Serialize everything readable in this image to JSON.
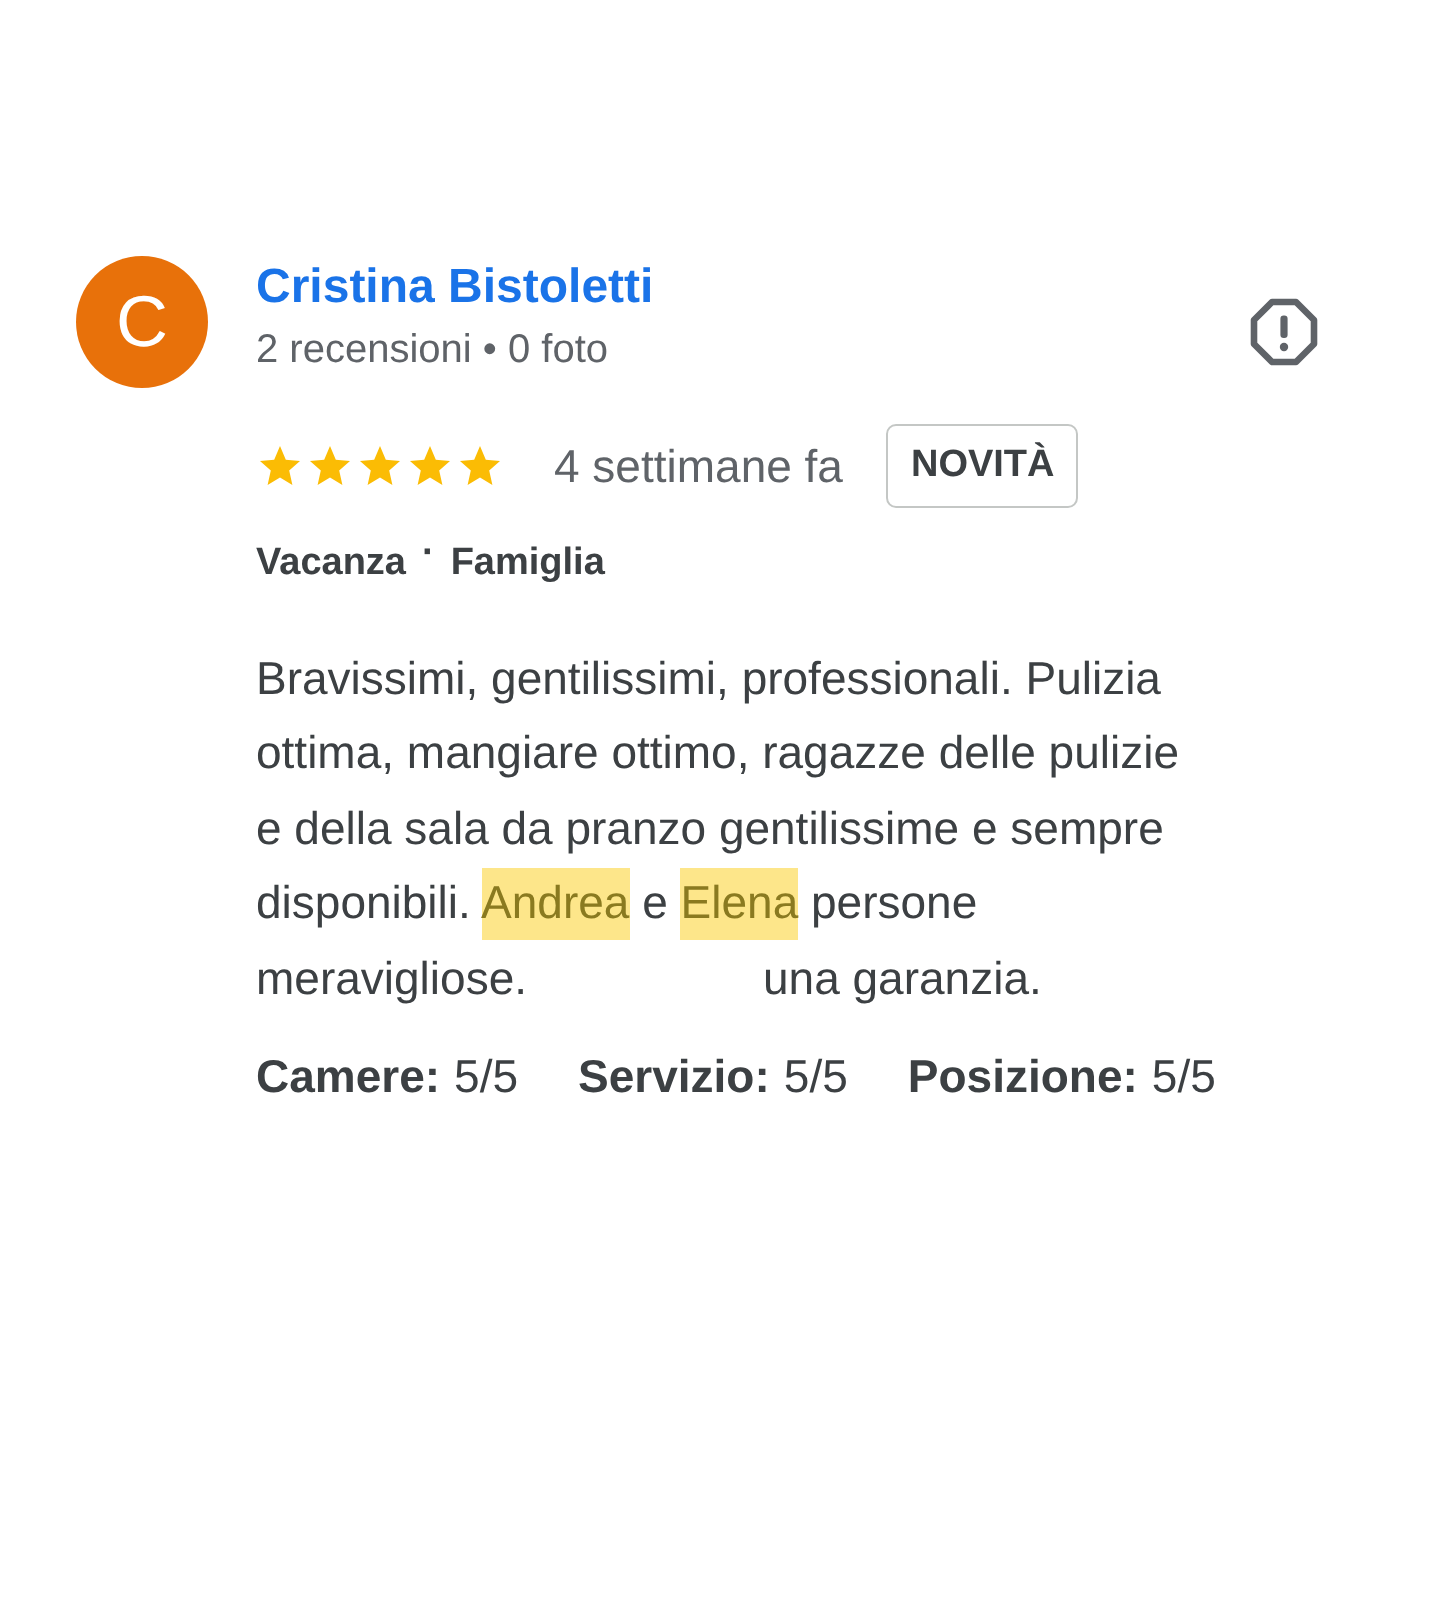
{
  "review": {
    "avatar_letter": "C",
    "color": "#e8710a",
    "author": "Cristina Bistoletti",
    "author_meta": "2 recensioni • 0 foto",
    "stars": 5,
    "time": "4 settimane fa",
    "badge": "NOVITÀ",
    "tags": [
      "Vacanza",
      "Famiglia"
    ],
    "tag_separator": "·",
    "text_lines": [
      [
        {
          "text": "Bravissimi, gentilissimi, professionali. Pulizia",
          "highlighted": false
        }
      ],
      [
        {
          "text": "ottima, mangiare ottimo, ragazze delle pulizie",
          "highlighted": false
        }
      ],
      [
        {
          "text": "e della sala da pranzo gentilissime e sempre",
          "highlighted": false
        }
      ],
      [
        {
          "text": "disponibili. ",
          "highlighted": false
        },
        {
          "text": "Andrea",
          "highlighted": true
        },
        {
          "text": " e ",
          "highlighted": false
        },
        {
          "text": "Elena",
          "highlighted": true
        },
        {
          "text": " persone",
          "highlighted": false
        }
      ],
      [
        {
          "text": "meravigliose.",
          "highlighted": false
        },
        {
          "kind": "redacted"
        },
        {
          "text": "una garanzia.",
          "highlighted": false
        }
      ]
    ],
    "ratings": [
      {
        "label": "Camere:",
        "value": "5/5"
      },
      {
        "label": "Servizio:",
        "value": "5/5"
      },
      {
        "label": "Posizione:",
        "value": "5/5"
      }
    ]
  }
}
